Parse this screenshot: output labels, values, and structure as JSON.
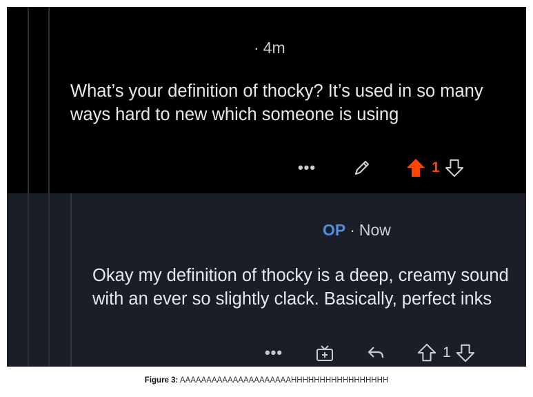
{
  "parent_comment": {
    "timestamp": "4m",
    "body": "What’s your definition of thocky? It’s used in so many ways hard to new which someone is using",
    "vote_count": "1",
    "colors": {
      "background": "#000000",
      "upvote_active": "#ff4500"
    },
    "icons": [
      "more-icon",
      "edit-icon",
      "upvote-icon",
      "downvote-icon"
    ]
  },
  "reply_comment": {
    "author_badge": "OP",
    "timestamp": "Now",
    "body": "Okay my definition of thocky is a deep, creamy sound with an ever so slightly clack. Basically, perfect inks",
    "vote_count": "1",
    "colors": {
      "background": "#1a1f27",
      "badge": "#4f8fe0"
    },
    "icons": [
      "more-icon",
      "award-icon",
      "reply-icon",
      "upvote-icon",
      "downvote-icon"
    ]
  },
  "caption": {
    "label": "Figure 3:",
    "text": "AAAAAAAAAAAAAAAAAAAAAHHHHHHHHHHHHHHHHH"
  }
}
